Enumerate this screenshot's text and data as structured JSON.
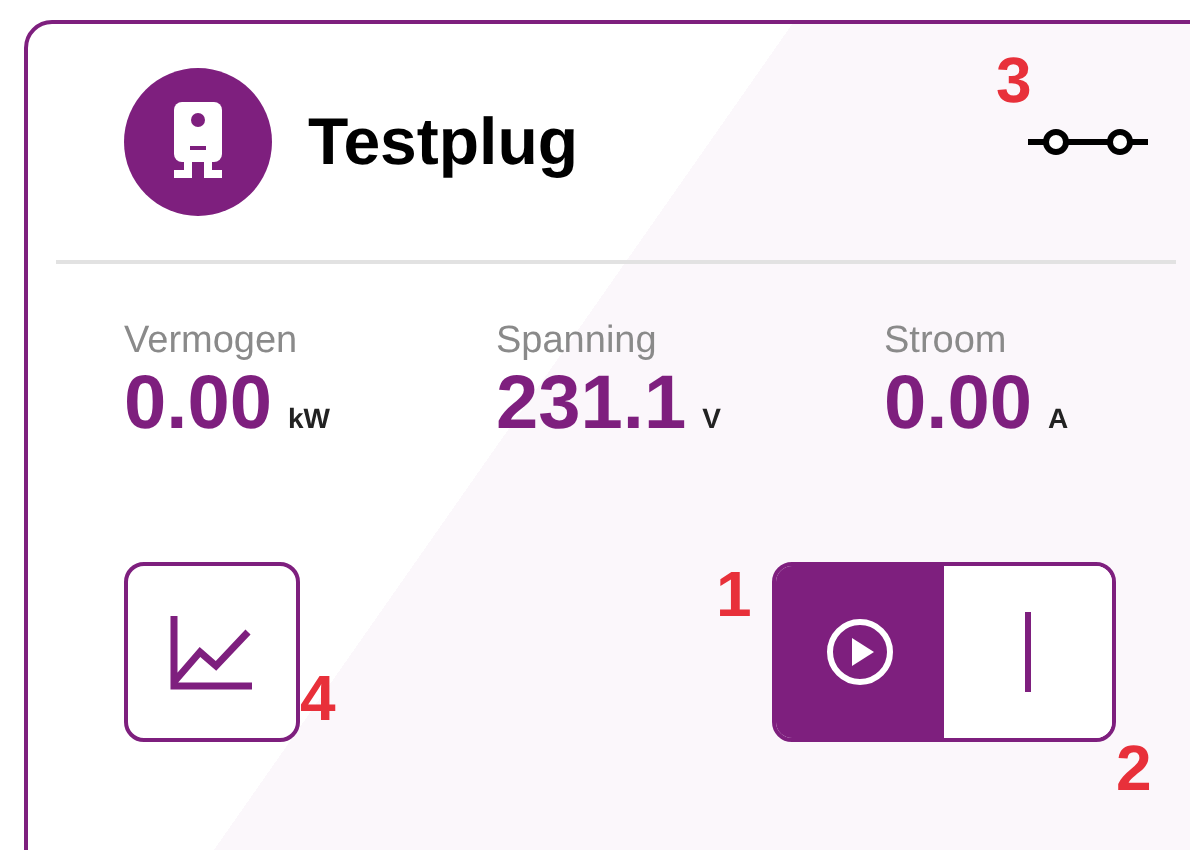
{
  "device": {
    "title": "Testplug"
  },
  "metrics": [
    {
      "label": "Vermogen",
      "value": "0.00",
      "unit": "kW"
    },
    {
      "label": "Spanning",
      "value": "231.1",
      "unit": "V"
    },
    {
      "label": "Stroom",
      "value": "0.00",
      "unit": "A"
    }
  ],
  "mode_toggle": [
    {
      "kind": "auto",
      "selected": true
    },
    {
      "kind": "on",
      "selected": false
    }
  ],
  "annotations": [
    "3",
    "1",
    "4",
    "2"
  ]
}
